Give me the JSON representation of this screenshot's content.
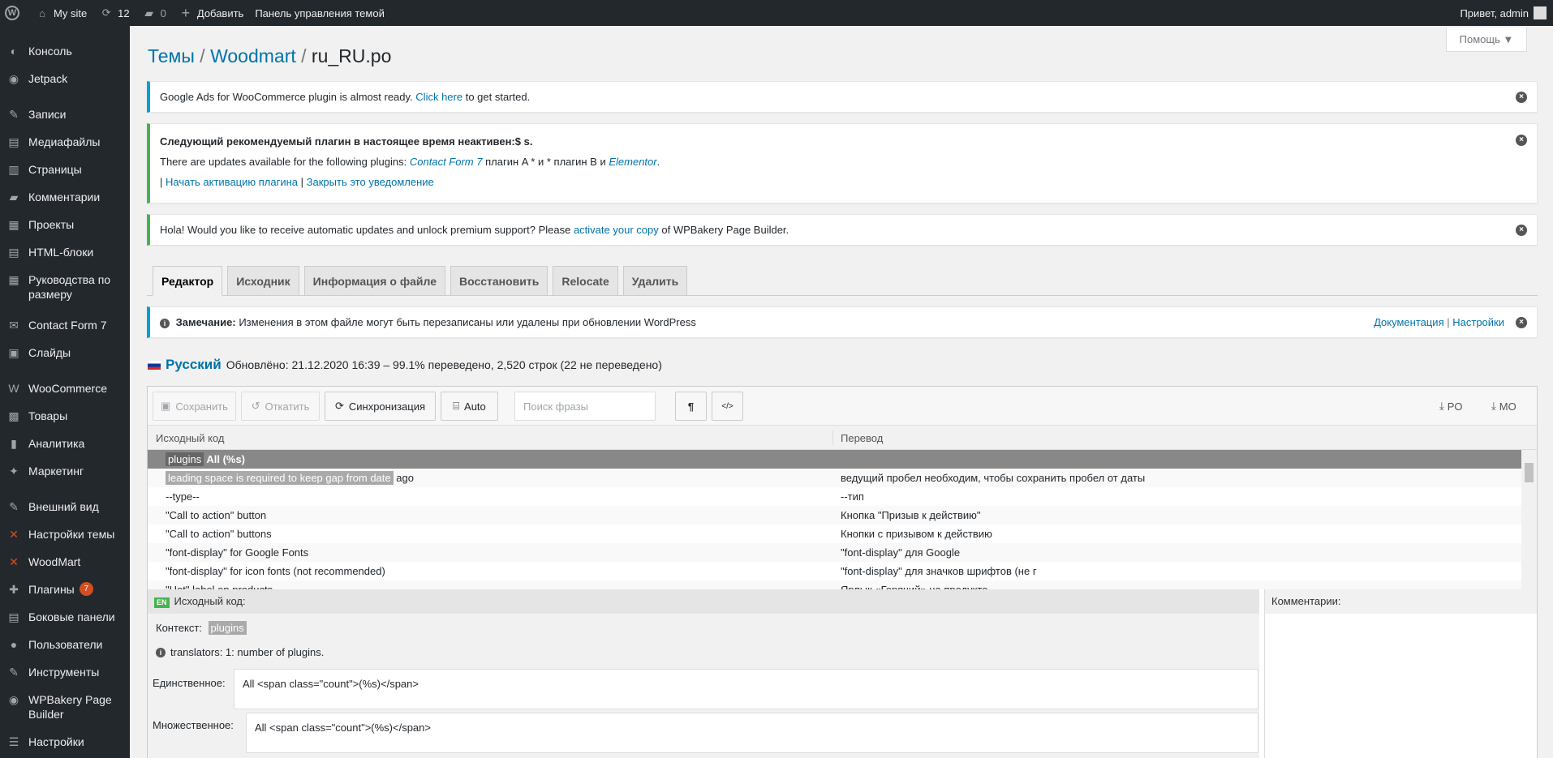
{
  "adminbar": {
    "site": "My site",
    "updates": "12",
    "comments": "0",
    "add": "Добавить",
    "theme_panel": "Панель управления темой",
    "greeting": "Привет, admin"
  },
  "sidebar": {
    "items": [
      {
        "label": "Консоль",
        "icon": "dashboard-icon"
      },
      {
        "label": "Jetpack",
        "icon": "jetpack-icon"
      },
      {
        "label": "Записи",
        "icon": "pin-icon"
      },
      {
        "label": "Медиафайлы",
        "icon": "media-icon"
      },
      {
        "label": "Страницы",
        "icon": "pages-icon"
      },
      {
        "label": "Комментарии",
        "icon": "comments-icon"
      },
      {
        "label": "Проекты",
        "icon": "portfolio-icon"
      },
      {
        "label": "HTML-блоки",
        "icon": "blocks-icon"
      },
      {
        "label": "Руководства по размеру",
        "icon": "size-guide-icon"
      },
      {
        "label": "Contact Form 7",
        "icon": "mail-icon"
      },
      {
        "label": "Слайды",
        "icon": "slides-icon"
      },
      {
        "label": "WooCommerce",
        "icon": "woo-icon"
      },
      {
        "label": "Товары",
        "icon": "products-icon"
      },
      {
        "label": "Аналитика",
        "icon": "analytics-icon"
      },
      {
        "label": "Маркетинг",
        "icon": "marketing-icon"
      },
      {
        "label": "Внешний вид",
        "icon": "appearance-icon"
      },
      {
        "label": "Настройки темы",
        "icon": "theme-settings-icon"
      },
      {
        "label": "WoodMart",
        "icon": "woodmart-icon"
      },
      {
        "label": "Плагины",
        "icon": "plugins-icon",
        "badge": "7"
      },
      {
        "label": "Боковые панели",
        "icon": "sidebars-icon"
      },
      {
        "label": "Пользователи",
        "icon": "users-icon"
      },
      {
        "label": "Инструменты",
        "icon": "tools-icon"
      },
      {
        "label": "WPBakery Page Builder",
        "icon": "wpbakery-icon"
      },
      {
        "label": "Настройки",
        "icon": "settings-icon"
      }
    ]
  },
  "help": "Помощь ▼",
  "title": {
    "part1": "Темы",
    "sep": " / ",
    "part2": "Woodmart",
    "part3": "ru_RU.po"
  },
  "notices": {
    "google_ads": {
      "text": "Google Ads for WooCommerce plugin is almost ready.",
      "link": "Click here",
      "after": "to get started."
    },
    "plugins": {
      "line1": "Следующий рекомендуемый плагин в настоящее время неактивен:$ s.",
      "line2_pre": "There are updates available for the following plugins:",
      "line2_link1": "Contact Form 7",
      "line2_mid": "плагин A * и * плагин B и",
      "line2_link2": "Elementor",
      "line2_end": ".",
      "line3_sep": "|",
      "line3_link1": "Начать активацию плагина",
      "line3_link2": "Закрыть это уведомление"
    },
    "wpbakery": {
      "pre": "Hola! Would you like to receive automatic updates and unlock premium support? Please",
      "link": "activate your copy",
      "post": "of WPBakery Page Builder."
    },
    "remark": {
      "label": "Замечание:",
      "text": "Изменения в этом файле могут быть перезаписаны или удалены при обновлении WordPress",
      "link1": "Документация",
      "sep": "|",
      "link2": "Настройки"
    }
  },
  "tabs": [
    "Редактор",
    "Исходник",
    "Информация о файле",
    "Восстановить",
    "Relocate",
    "Удалить"
  ],
  "lang": {
    "name": "Русский",
    "status": "Обновлёно: 21.12.2020 16:39 – 99.1% переведено, 2,520 строк (22 не переведено)"
  },
  "toolbar": {
    "save": "Сохранить",
    "revert": "Откатить",
    "sync": "Синхронизация",
    "auto": "Auto",
    "search_placeholder": "Поиск фразы",
    "pilcrow": "¶",
    "code": "</>",
    "po": "PO",
    "mo": "MO"
  },
  "columns": {
    "source": "Исходный код",
    "translation": "Перевод"
  },
  "rows": [
    {
      "src_hl": "plugins",
      "src": "All (%s)",
      "tr": ""
    },
    {
      "src_hl": "leading space is required to keep gap from date",
      "src": "ago",
      "tr": "ведущий пробел необходим, чтобы сохранить пробел от даты"
    },
    {
      "src_hl": "",
      "src": "--type--",
      "tr": "--тип"
    },
    {
      "src_hl": "",
      "src": "\"Call to action\" button",
      "tr": "Кнопка \"Призыв к действию\""
    },
    {
      "src_hl": "",
      "src": "\"Call to action\" buttons",
      "tr": "Кнопки с призывом к действию"
    },
    {
      "src_hl": "",
      "src": "\"font-display\" for Google Fonts",
      "tr": "\"font-display\" для Google"
    },
    {
      "src_hl": "",
      "src": "\"font-display\" for icon fonts (not recommended)",
      "tr": "\"font-display\" для значков шрифтов (не г"
    },
    {
      "src_hl": "",
      "src": "\"Hot\" label on products",
      "tr": "Ярлык «Горячий» на продукте"
    }
  ],
  "source_pane": {
    "badge": "EN",
    "title": "Исходный код:",
    "context_label": "Контекст:",
    "context_value": "plugins",
    "note": "translators: 1: number of plugins.",
    "singular_label": "Единственное:",
    "singular_value": "All <span class=\"count\">(%s)</span>",
    "plural_label": "Множественное:",
    "plural_value": "All <span class=\"count\">(%s)</span>"
  },
  "comments_pane": {
    "title": "Комментарии:"
  }
}
